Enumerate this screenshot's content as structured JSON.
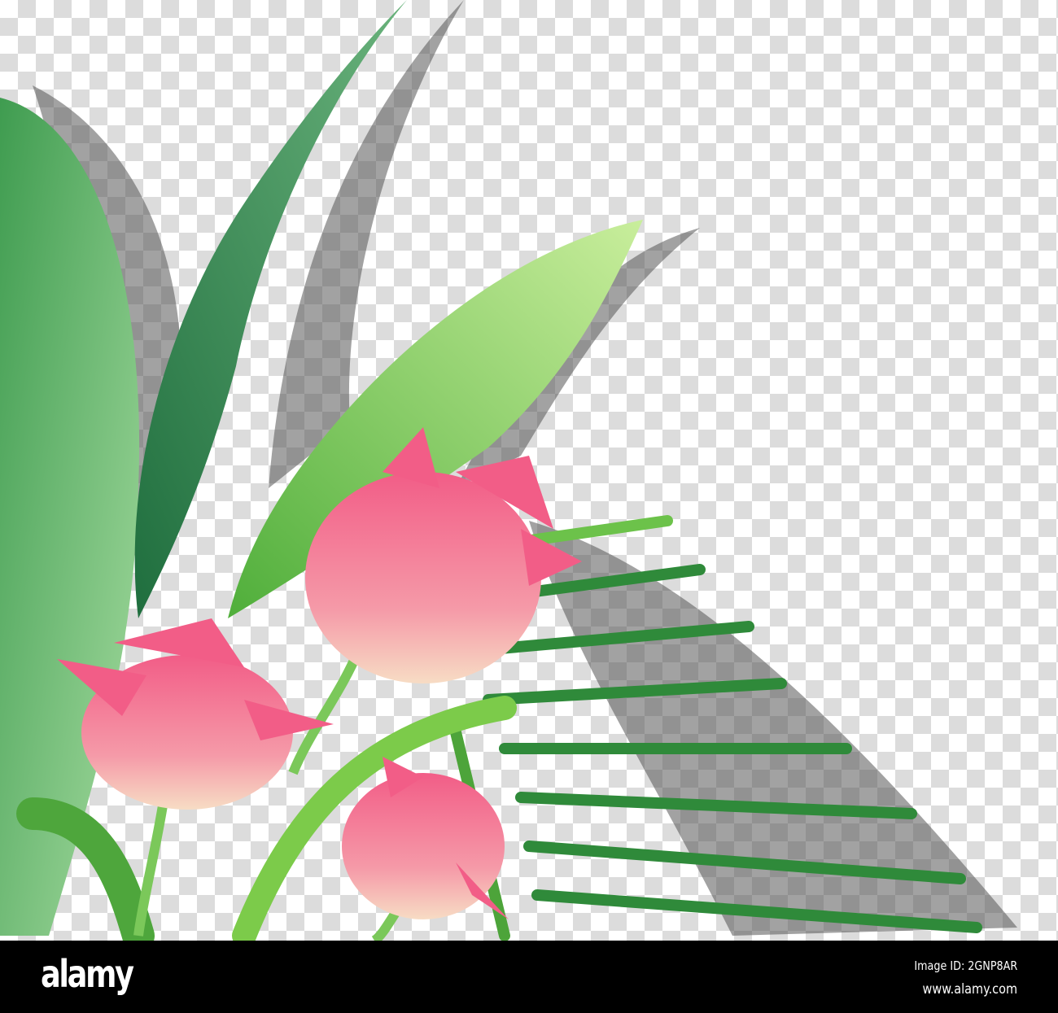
{
  "footer": {
    "logo": "alamy",
    "image_id": "Image ID: 2GNP8AR",
    "site": "www.alamy.com"
  },
  "watermark": "alamy",
  "colors": {
    "dark_leaf": "#2e8b57",
    "light_leaf": "#8fd45a",
    "tulip": "#f06a8a",
    "tulip_base": "#f5d7c4",
    "shadow": "#6e6e6e"
  }
}
